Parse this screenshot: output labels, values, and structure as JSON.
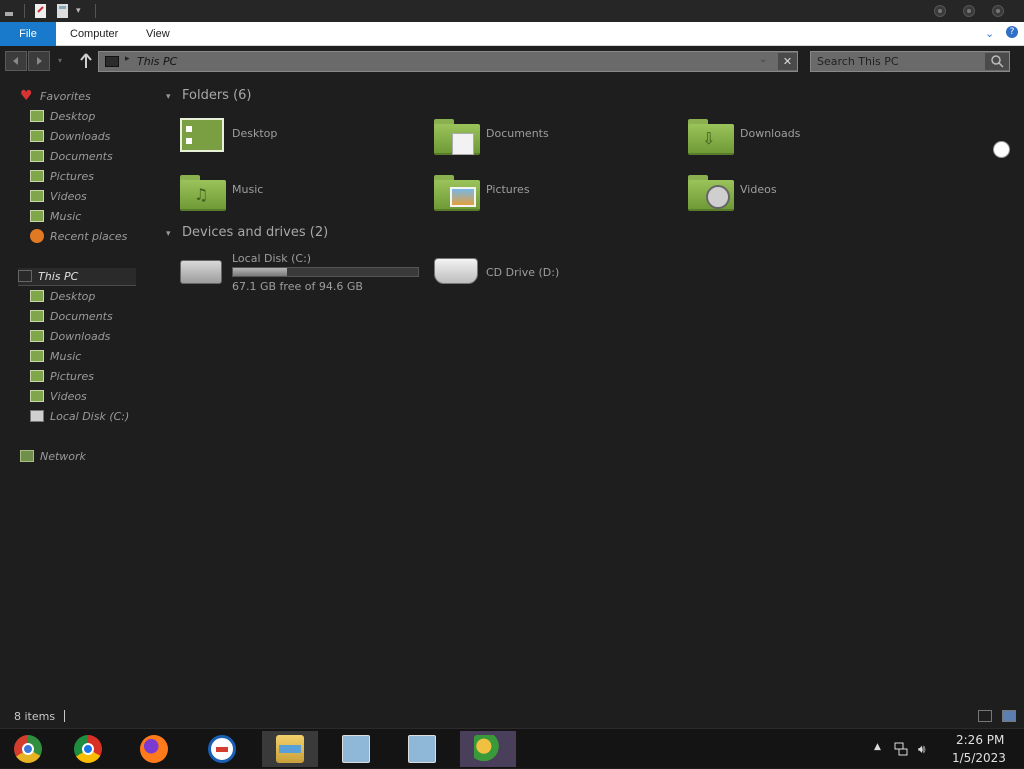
{
  "ribbon": {
    "file": "File",
    "computer": "Computer",
    "view": "View"
  },
  "address": {
    "location": "This PC"
  },
  "search": {
    "placeholder": "Search This PC"
  },
  "sidebar": {
    "favorites": "Favorites",
    "fav_items": [
      "Desktop",
      "Downloads",
      "Documents",
      "Pictures",
      "Videos",
      "Music",
      "Recent places"
    ],
    "this_pc": "This PC",
    "pc_items": [
      "Desktop",
      "Documents",
      "Downloads",
      "Music",
      "Pictures",
      "Videos",
      "Local Disk (C:)"
    ],
    "network": "Network"
  },
  "content": {
    "folders_header": "Folders (6)",
    "folders": [
      "Desktop",
      "Documents",
      "Downloads",
      "Music",
      "Pictures",
      "Videos"
    ],
    "devices_header": "Devices and drives (2)",
    "drives": [
      {
        "name": "Local Disk (C:)",
        "free_text": "67.1 GB free of 94.6 GB",
        "used_fraction": 0.29
      },
      {
        "name": "CD Drive (D:)"
      }
    ]
  },
  "status": {
    "item_count": "8 items"
  },
  "taskbar": {
    "apps": [
      "chromium-icon",
      "chrome-icon",
      "firefox-icon",
      "opera-icon",
      "file-explorer-icon",
      "installer-icon",
      "installer-icon",
      "users-app-icon"
    ],
    "time": "2:26 PM",
    "date": "1/5/2023"
  },
  "colors": {
    "accent": "#1979ca",
    "folder_green": "#8ab04f",
    "background": "#1e1e1e"
  }
}
